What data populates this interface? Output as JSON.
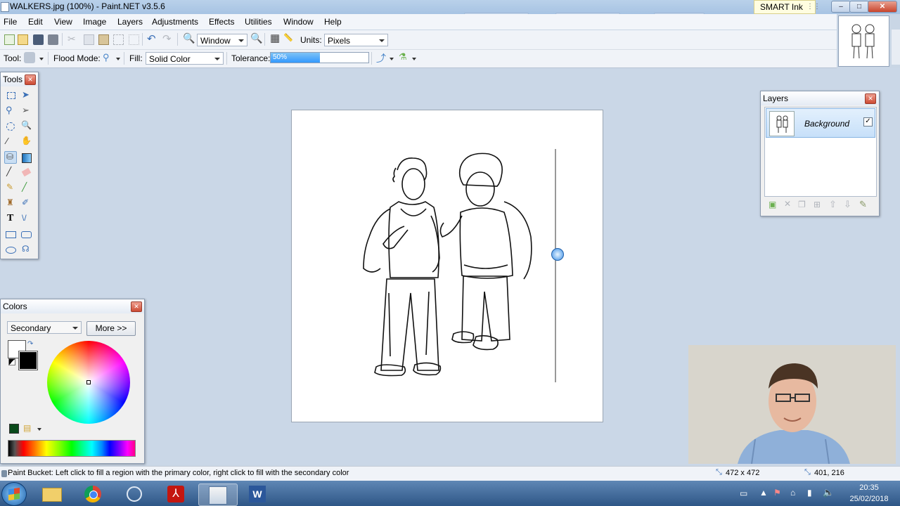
{
  "window": {
    "title": "WALKERS.jpg (100%) - Paint.NET v3.5.6",
    "minimize": "–",
    "maximize": "□",
    "close": "✕"
  },
  "smart_ink": {
    "label": "SMART Ink"
  },
  "menu": [
    "File",
    "Edit",
    "View",
    "Image",
    "Layers",
    "Adjustments",
    "Effects",
    "Utilities",
    "Window",
    "Help"
  ],
  "toolbar": {
    "zoom_value": "Window",
    "units_label": "Units:",
    "units_value": "Pixels"
  },
  "tool_options": {
    "tool_label": "Tool:",
    "flood_mode_label": "Flood Mode:",
    "fill_label": "Fill:",
    "fill_value": "Solid Color",
    "tolerance_label": "Tolerance:",
    "tolerance_value": "50%",
    "tolerance_fraction": 0.5
  },
  "tools_panel": {
    "title": "Tools"
  },
  "colors_panel": {
    "title": "Colors",
    "mode": "Secondary",
    "more_button": "More >>",
    "primary_color": "#000000",
    "secondary_color": "#ffffff"
  },
  "layers_panel": {
    "title": "Layers",
    "layers": [
      {
        "name": "Background",
        "visible": true
      }
    ]
  },
  "status": {
    "hint": "Paint Bucket: Left click to fill a region with the primary color, right click to fill with the secondary color",
    "image_size": "472 x 472",
    "cursor_pos": "401, 216"
  },
  "taskbar": {
    "time": "20:35",
    "date": "25/02/2018"
  },
  "colors": {
    "accent": "#3399ff",
    "titlebar": "#b9d1ea",
    "workspace": "#cad7e7"
  }
}
